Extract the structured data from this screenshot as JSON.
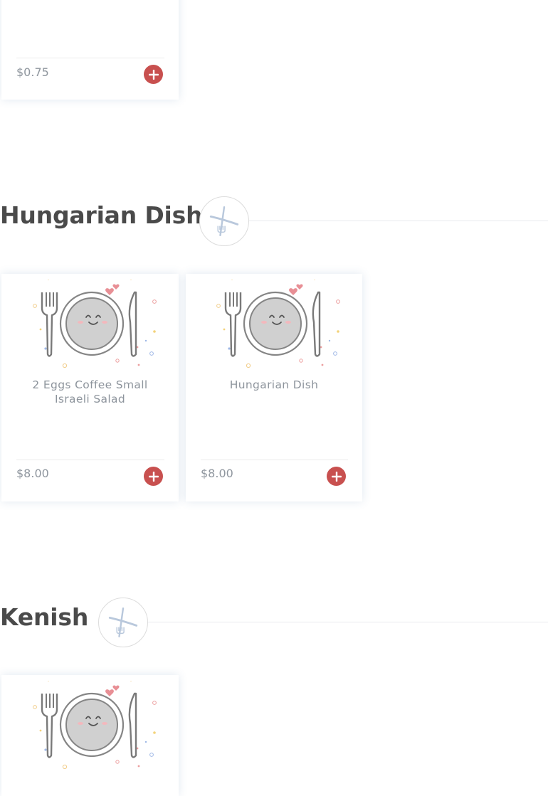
{
  "sections": [
    {
      "title": "",
      "items": [
        {
          "name": "",
          "price": "$0.75",
          "add_icon": "plus-circle-icon"
        }
      ]
    },
    {
      "title": "Hungarian Dish",
      "icon": "fork-knife-crossed-icon",
      "items": [
        {
          "name": "2 Eggs Coffee Small Israeli Salad",
          "price": "$8.00",
          "image_icon": "plate-placeholder-icon",
          "add_icon": "plus-circle-icon"
        },
        {
          "name": "Hungarian Dish",
          "price": "$8.00",
          "image_icon": "plate-placeholder-icon",
          "add_icon": "plus-circle-icon"
        }
      ]
    },
    {
      "title": "Kenish",
      "icon": "fork-knife-crossed-icon",
      "items": [
        {
          "name": "",
          "price": "",
          "image_icon": "plate-placeholder-icon"
        }
      ]
    }
  ],
  "colors": {
    "accent": "#c8504f",
    "heading": "#4a4a4a",
    "muted_text": "#8d949c",
    "divider": "#e9ebee"
  }
}
